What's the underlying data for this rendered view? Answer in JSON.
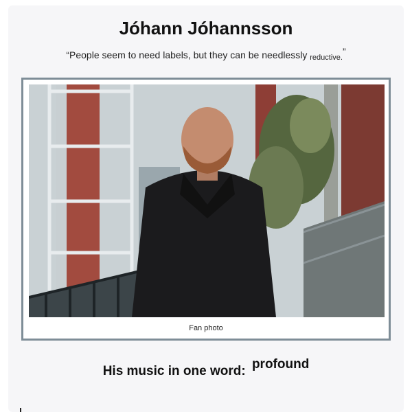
{
  "header": {
    "title": "Jóhann Jóhannsson"
  },
  "quote": {
    "open_mark": "“",
    "text_main": "People seem to need labels, but they can be ",
    "word_1": "needlessly",
    "word_2": "reductive.",
    "close_mark": "”"
  },
  "photo": {
    "caption": "Fan photo"
  },
  "footer": {
    "prefix": "His music in one word: ",
    "word": "profound"
  }
}
